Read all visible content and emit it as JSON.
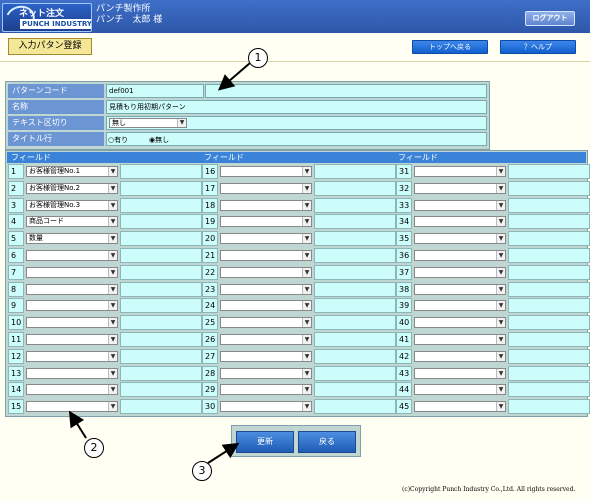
{
  "header": {
    "logo_line1": "ネット注文",
    "logo_line2": "PUNCH INDUSTRY",
    "company": "パンチ製作所",
    "user": "パンチ　太郎 様",
    "logout": "ログアウト"
  },
  "page": {
    "title": "入力パタン登録",
    "top_button": "トップへ戻る",
    "help_button": "？ヘルプ"
  },
  "form": {
    "pattern_code_label": "パターンコード",
    "pattern_code_value": "def001",
    "name_label": "名称",
    "name_value": "見積もり用初期パターン",
    "text_sep_label": "テキスト区切り",
    "text_sep_value": "無し",
    "title_row_label": "タイトル行",
    "radio_yes": "有り",
    "radio_no": "無し",
    "radio_selected": "無し"
  },
  "grid": {
    "column_header": "フィールド",
    "rows": [
      {
        "n": "1",
        "v": "お客様管理No.1"
      },
      {
        "n": "2",
        "v": "お客様管理No.2"
      },
      {
        "n": "3",
        "v": "お客様管理No.3"
      },
      {
        "n": "4",
        "v": "商品コード"
      },
      {
        "n": "5",
        "v": "数量"
      },
      {
        "n": "6",
        "v": ""
      },
      {
        "n": "7",
        "v": ""
      },
      {
        "n": "8",
        "v": ""
      },
      {
        "n": "9",
        "v": ""
      },
      {
        "n": "10",
        "v": ""
      },
      {
        "n": "11",
        "v": ""
      },
      {
        "n": "12",
        "v": ""
      },
      {
        "n": "13",
        "v": ""
      },
      {
        "n": "14",
        "v": ""
      },
      {
        "n": "15",
        "v": ""
      },
      {
        "n": "16",
        "v": ""
      },
      {
        "n": "17",
        "v": ""
      },
      {
        "n": "18",
        "v": ""
      },
      {
        "n": "19",
        "v": ""
      },
      {
        "n": "20",
        "v": ""
      },
      {
        "n": "21",
        "v": ""
      },
      {
        "n": "22",
        "v": ""
      },
      {
        "n": "23",
        "v": ""
      },
      {
        "n": "24",
        "v": ""
      },
      {
        "n": "25",
        "v": ""
      },
      {
        "n": "26",
        "v": ""
      },
      {
        "n": "27",
        "v": ""
      },
      {
        "n": "28",
        "v": ""
      },
      {
        "n": "29",
        "v": ""
      },
      {
        "n": "30",
        "v": ""
      },
      {
        "n": "31",
        "v": ""
      },
      {
        "n": "32",
        "v": ""
      },
      {
        "n": "33",
        "v": ""
      },
      {
        "n": "34",
        "v": ""
      },
      {
        "n": "35",
        "v": ""
      },
      {
        "n": "36",
        "v": ""
      },
      {
        "n": "37",
        "v": ""
      },
      {
        "n": "38",
        "v": ""
      },
      {
        "n": "39",
        "v": ""
      },
      {
        "n": "40",
        "v": ""
      },
      {
        "n": "41",
        "v": ""
      },
      {
        "n": "42",
        "v": ""
      },
      {
        "n": "43",
        "v": ""
      },
      {
        "n": "44",
        "v": ""
      },
      {
        "n": "45",
        "v": ""
      }
    ]
  },
  "actions": {
    "update": "更新",
    "back": "戻る"
  },
  "callouts": [
    "1",
    "2",
    "3"
  ],
  "footer": "(c)Copyright Punch Industry Co.,Ltd. All rights reserved."
}
